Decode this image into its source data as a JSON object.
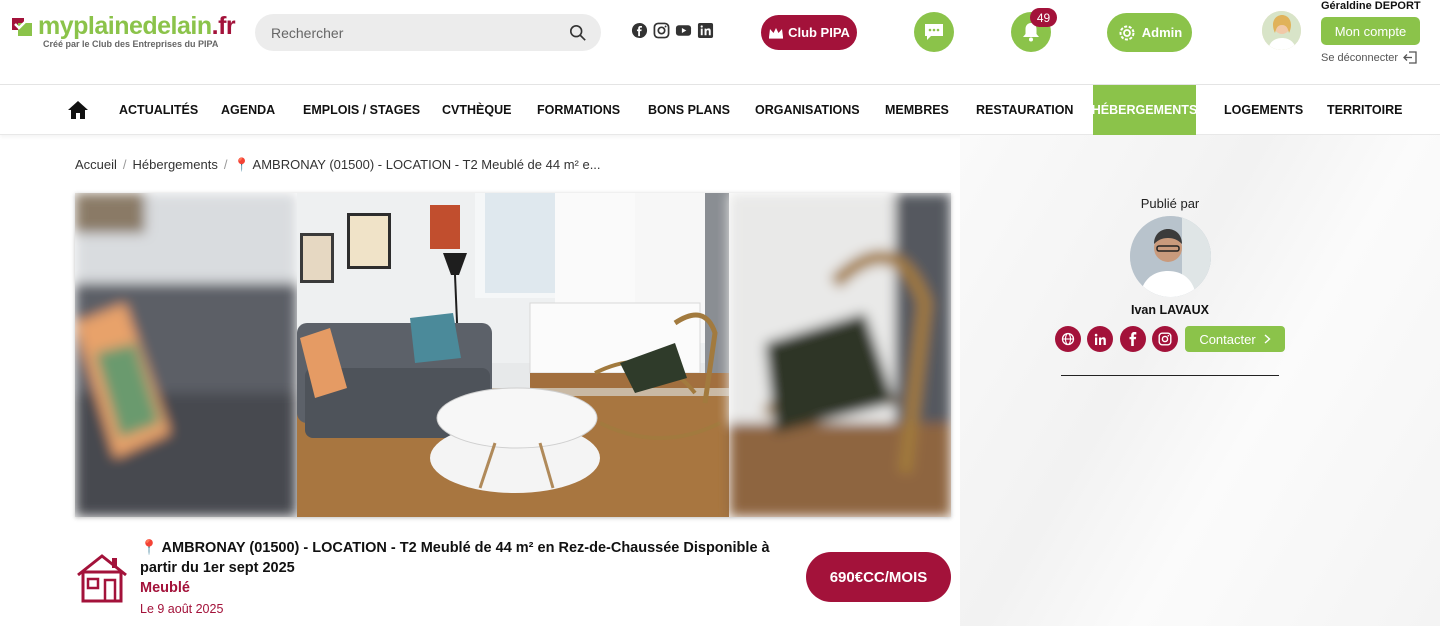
{
  "header": {
    "logo": {
      "brand_plain": "myplainedelain",
      "brand_tld": ".fr",
      "tagline": "Créé par le Club des Entreprises du PIPA"
    },
    "search": {
      "placeholder": "Rechercher"
    },
    "socials": [
      "facebook-icon",
      "instagram-icon",
      "youtube-icon",
      "linkedin-icon"
    ],
    "club_button": "Club PIPA",
    "notifications_count": "49",
    "admin_button": "Admin",
    "user": {
      "name": "Géraldine DEPORT",
      "account_button": "Mon compte",
      "logout": "Se déconnecter"
    }
  },
  "nav": {
    "items": [
      {
        "label": "ACTUALITÉS"
      },
      {
        "label": "AGENDA"
      },
      {
        "label": "EMPLOIS / STAGES"
      },
      {
        "label": "CVTHÈQUE"
      },
      {
        "label": "FORMATIONS"
      },
      {
        "label": "BONS PLANS"
      },
      {
        "label": "ORGANISATIONS"
      },
      {
        "label": "MEMBRES"
      },
      {
        "label": "RESTAURATION"
      },
      {
        "label": "HÉBERGEMENTS",
        "active": true
      },
      {
        "label": "LOGEMENTS"
      },
      {
        "label": "TERRITOIRE"
      }
    ]
  },
  "breadcrumb": {
    "home": "Accueil",
    "section": "Hébergements",
    "current": "📍 AMBRONAY (01500) - LOCATION - T2 Meublé de 44 m² e..."
  },
  "listing": {
    "title": "📍 AMBRONAY (01500) - LOCATION - T2 Meublé de 44 m² en Rez-de-Chaussée Disponible à partir du 1er sept 2025",
    "type": "Meublé",
    "date": "Le 9 août 2025",
    "price": "690€CC/MOIS"
  },
  "publisher": {
    "label": "Publié par",
    "name": "Ivan LAVAUX",
    "contact_button": "Contacter"
  },
  "colors": {
    "brand_green": "#8bc34a",
    "brand_red": "#a3123a"
  }
}
